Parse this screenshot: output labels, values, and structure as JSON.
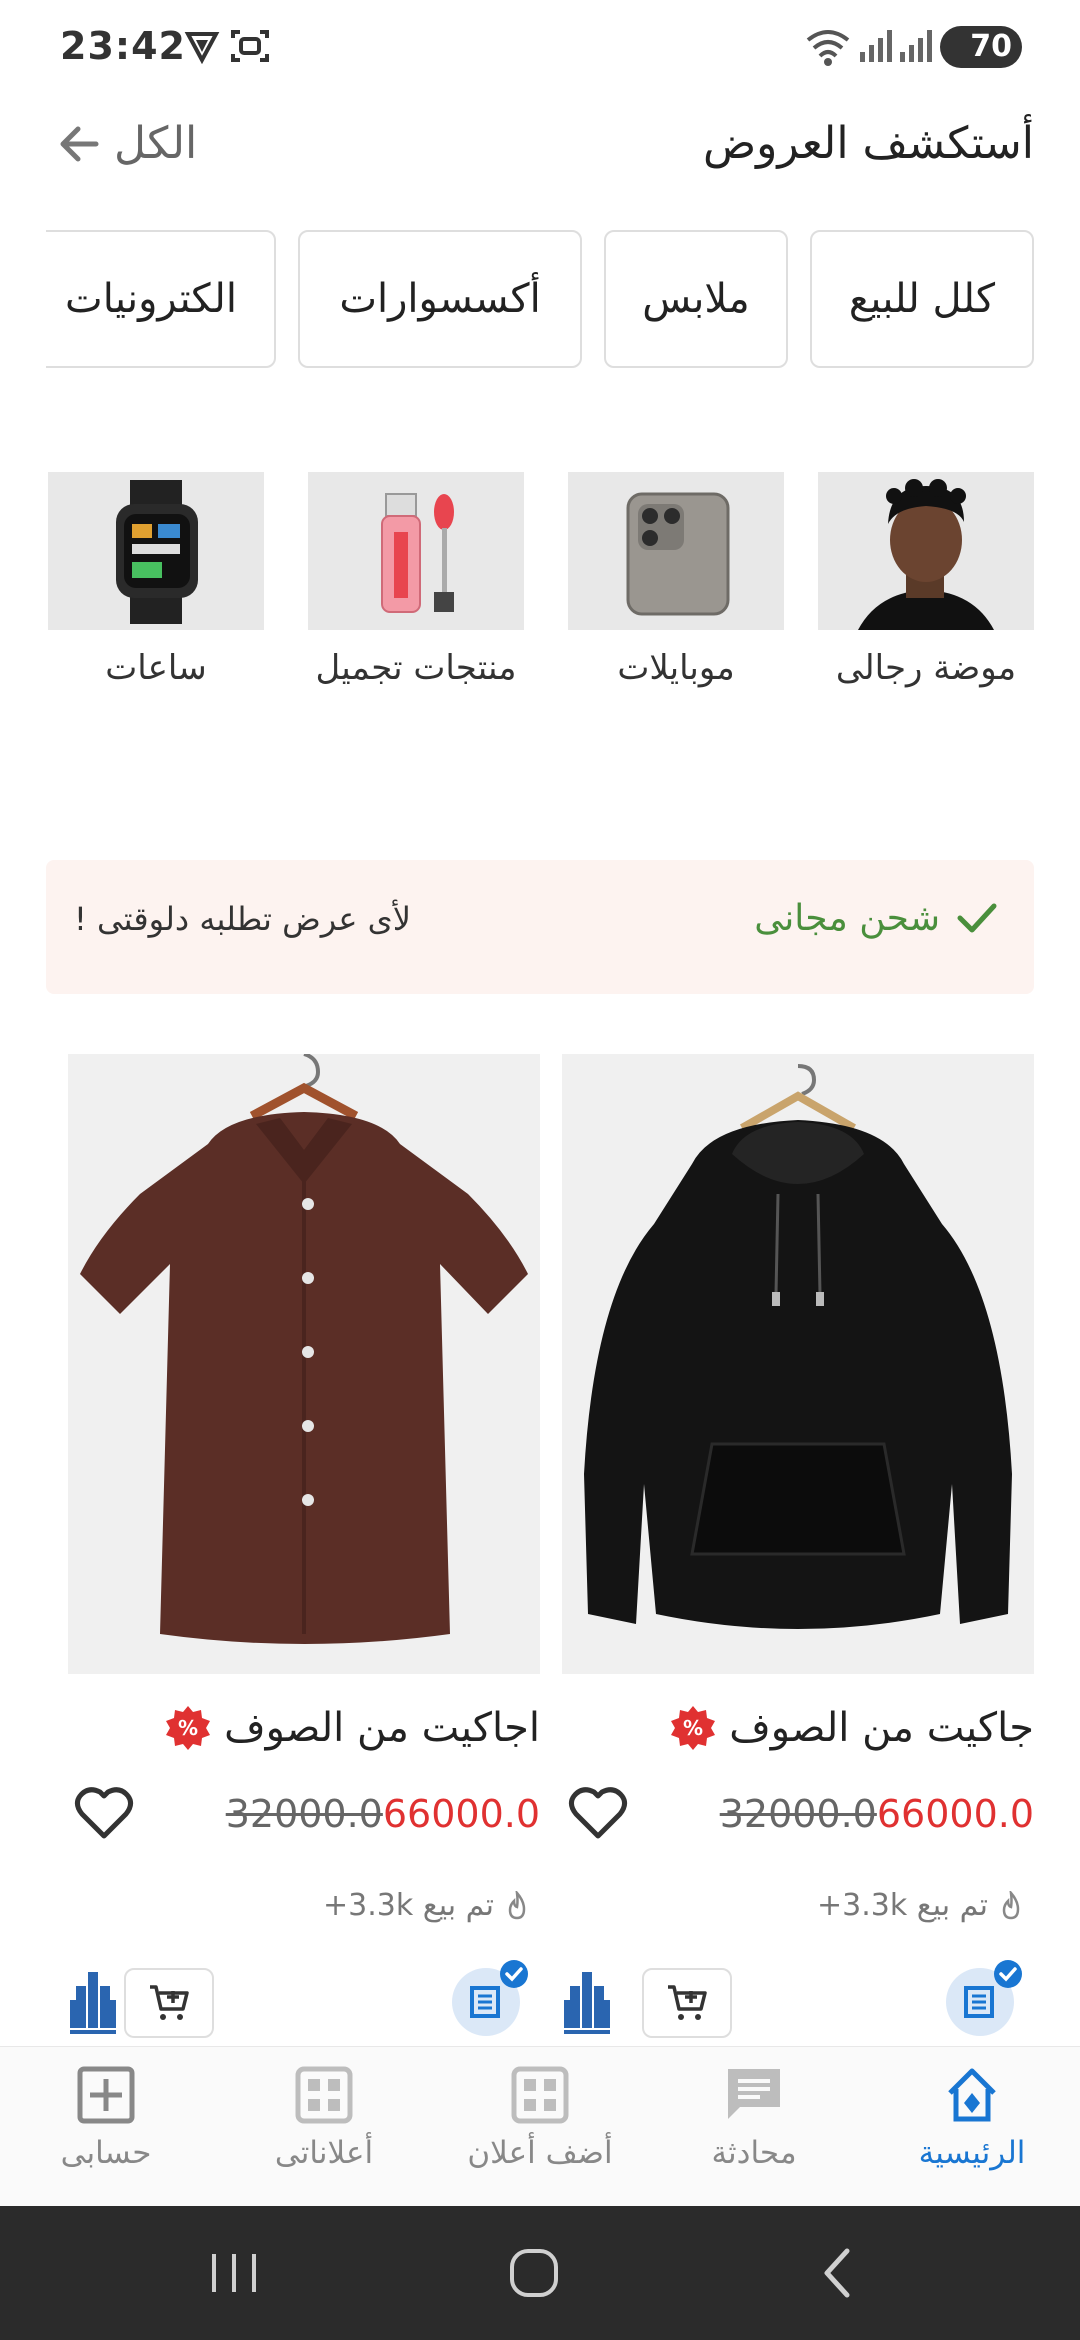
{
  "status_bar": {
    "time": "23:42",
    "battery": "70",
    "icons": [
      "vpn-icon",
      "screenshot-icon",
      "wifi-icon",
      "signal-icon",
      "signal-icon"
    ]
  },
  "header": {
    "title": "أستكشف العروض",
    "see_all_label": "الكل",
    "see_all_icon": "arrow-left-icon"
  },
  "chips": [
    {
      "label": "كلل للبيع"
    },
    {
      "label": "ملابس"
    },
    {
      "label": "أكسسوارات"
    },
    {
      "label": "الكترونيات"
    }
  ],
  "image_categories": [
    {
      "label": "موضة رجالى",
      "icon": "man-portrait-icon"
    },
    {
      "label": "موبايلات",
      "icon": "smartphone-icon"
    },
    {
      "label": "منتجات تجميل",
      "icon": "lip-gloss-icon"
    },
    {
      "label": "ساعات",
      "icon": "smartwatch-icon"
    }
  ],
  "promo": {
    "shipping_label": "شحن مجانى",
    "note": "لأى عرض تطلبه دلوقتى !"
  },
  "products": [
    {
      "title": "جاكيت من الصوف",
      "old_price": "32000.0",
      "new_price": "66000.0",
      "sold": "تم بيع 3.3k+",
      "image": "black-hoodie"
    },
    {
      "title": "اجاكيت من الصوف",
      "old_price": "32000.0",
      "new_price": "66000.0",
      "sold": "تم بيع 3.3k+",
      "image": "brown-shirt"
    }
  ],
  "bottom_nav": [
    {
      "label": "الرئيسية",
      "icon": "home-icon",
      "active": true
    },
    {
      "label": "محادثة",
      "icon": "chat-icon",
      "active": false
    },
    {
      "label": "أضف أعلان",
      "icon": "grid-icon",
      "active": false
    },
    {
      "label": "أعلاناتى",
      "icon": "grid-icon",
      "active": false
    },
    {
      "label": "حسابى",
      "icon": "add-box-icon",
      "active": false
    }
  ],
  "colors": {
    "accent": "#1976d2",
    "price": "#e03131",
    "shipping": "#4a8f3c",
    "promo_bg": "#fdf3f0"
  }
}
